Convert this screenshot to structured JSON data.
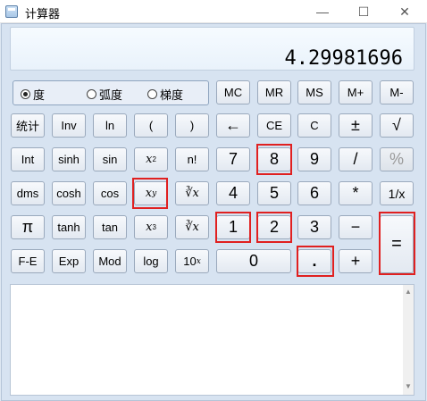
{
  "window": {
    "title": "计算器",
    "minimize": "—",
    "maximize": "☐",
    "close": "✕"
  },
  "display": {
    "value": "4.29981696"
  },
  "angle": {
    "deg": "度",
    "rad": "弧度",
    "grad": "梯度"
  },
  "memory": {
    "mc": "MC",
    "mr": "MR",
    "ms": "MS",
    "mplus": "M+",
    "mminus": "M-"
  },
  "sci": {
    "stat": "统计",
    "inv": "Inv",
    "ln": "ln",
    "lparen": "(",
    "rparen": ")",
    "int": "Int",
    "sinh": "sinh",
    "sin": "sin",
    "x2": "x",
    "x2_sup": "2",
    "nfact": "n!",
    "dms": "dms",
    "cosh": "cosh",
    "cos": "cos",
    "xy": "x",
    "xy_sup": "y",
    "yroot": "∛x",
    "pi": "π",
    "tanh": "tanh",
    "tan": "tan",
    "x3": "x",
    "x3_sup": "3",
    "cuberoot": "∛x",
    "fe": "F-E",
    "exp": "Exp",
    "mod": "Mod",
    "log": "log",
    "tenx": "10",
    "tenx_sup": "x"
  },
  "keys": {
    "back": "←",
    "ce": "CE",
    "c": "C",
    "plusminus": "±",
    "sqrt": "√",
    "seven": "7",
    "eight": "8",
    "nine": "9",
    "div": "/",
    "pct": "%",
    "four": "4",
    "five": "5",
    "six": "6",
    "mul": "*",
    "recip": "1/x",
    "one": "1",
    "two": "2",
    "three": "3",
    "minus": "−",
    "equals": "=",
    "zero": "0",
    "dot": ".",
    "plus": "+"
  },
  "scrollbar": {
    "up": "▲",
    "down": "▼"
  }
}
